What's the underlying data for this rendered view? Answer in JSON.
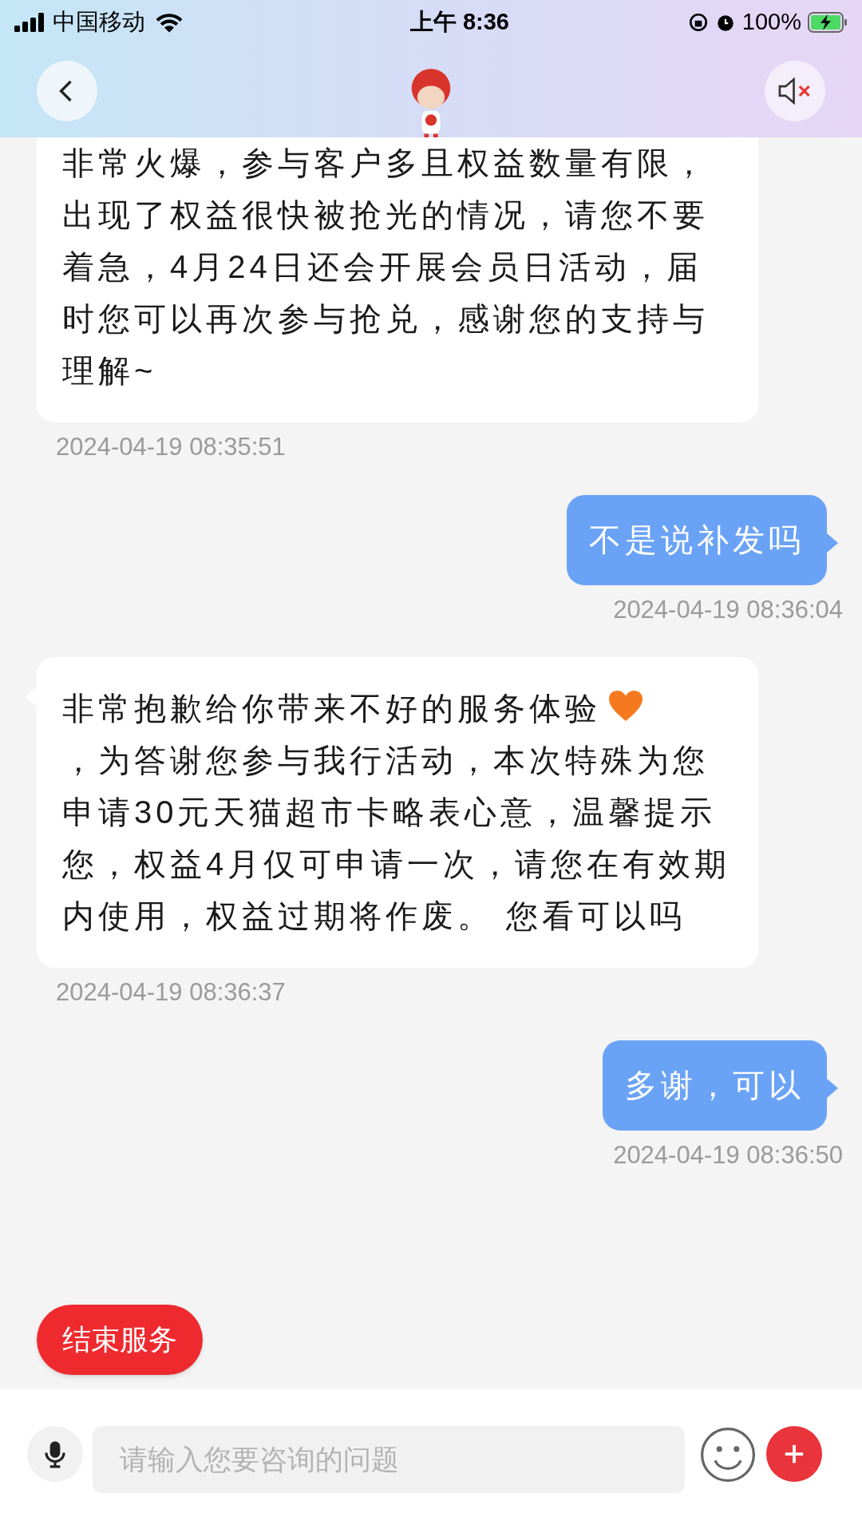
{
  "status_bar": {
    "carrier": "中国移动",
    "time": "上午 8:36",
    "battery": "100%"
  },
  "messages": [
    {
      "kind": "agent",
      "cut_top": true,
      "parts": [
        {
          "kind": "text",
          "text": "非常火爆，参与客户多且权益数量有限，出现了权益很快被抢光的情况，请您不要着急，4月24日还会开展会员日活动，届时您可以再次参与抢兑，感谢您的支持与理解~"
        }
      ],
      "time": "2024-04-19 08:35:51"
    },
    {
      "kind": "user",
      "cut_top": false,
      "parts": [
        {
          "kind": "text",
          "text": "不是说补发吗"
        }
      ],
      "time": "2024-04-19 08:36:04"
    },
    {
      "kind": "agent",
      "cut_top": false,
      "parts": [
        {
          "kind": "text",
          "text": "非常抱歉给你带来不好的服务体验"
        },
        {
          "kind": "heart"
        },
        {
          "kind": "text",
          "text": "，为答谢您参与我行活动，本次特殊为您申请30元天猫超市卡略表心意，温馨提示您，权益4月仅可申请一次，请您在有效期内使用，权益过期将作废。 您看可以吗"
        }
      ],
      "time": "2024-04-19 08:36:37"
    },
    {
      "kind": "user",
      "cut_top": false,
      "parts": [
        {
          "kind": "text",
          "text": "多谢，可以"
        }
      ],
      "time": "2024-04-19 08:36:50"
    }
  ],
  "end_button": "结束服务",
  "input": {
    "placeholder": "请输入您要咨询的问题"
  }
}
